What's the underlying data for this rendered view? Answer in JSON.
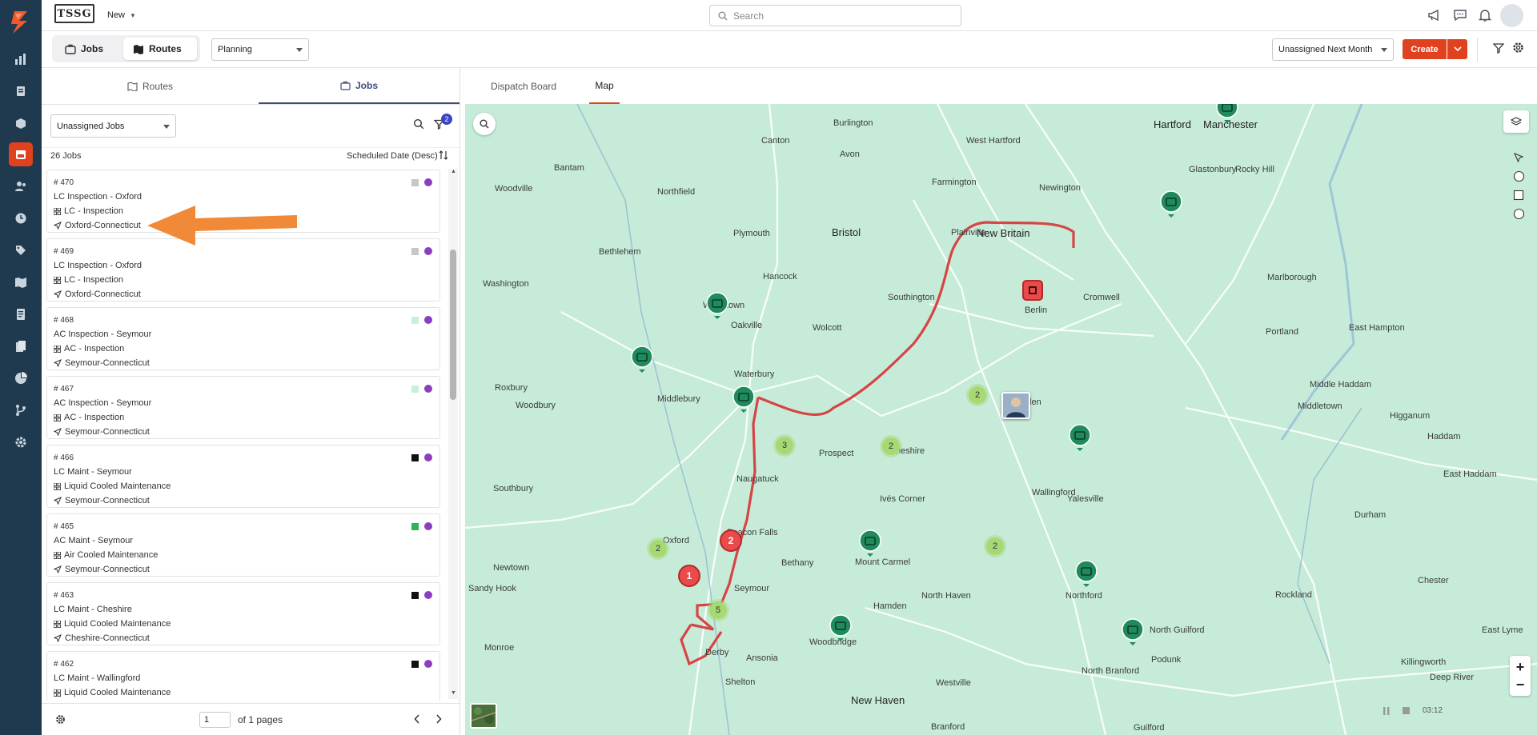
{
  "app": {
    "logo_text": "TSSG",
    "new_label": "New",
    "search_placeholder": "Search"
  },
  "subbar": {
    "jobs_tab": "Jobs",
    "routes_tab": "Routes",
    "mode_select": "Planning",
    "filter_select": "Unassigned Next Month",
    "create_label": "Create"
  },
  "panel": {
    "tabs": [
      "Routes",
      "Jobs"
    ],
    "active_tab": "Jobs",
    "list_select": "Unassigned Jobs",
    "filter_badge": "2",
    "count": "26 Jobs",
    "sort_label": "Scheduled Date (Desc)",
    "jobs": [
      {
        "num": "# 470",
        "title": "LC Inspection - Oxford",
        "type": "LC - Inspection",
        "loc": "Oxford-Connecticut",
        "swatch": "#c7c7c7"
      },
      {
        "num": "# 469",
        "title": "LC Inspection - Oxford",
        "type": "LC - Inspection",
        "loc": "Oxford-Connecticut",
        "swatch": "#c7c7c7"
      },
      {
        "num": "# 468",
        "title": "AC Inspection - Seymour",
        "type": "AC - Inspection",
        "loc": "Seymour-Connecticut",
        "swatch": "#c9f0d8"
      },
      {
        "num": "# 467",
        "title": "AC Inspection - Seymour",
        "type": "AC - Inspection",
        "loc": "Seymour-Connecticut",
        "swatch": "#c9f0d8"
      },
      {
        "num": "# 466",
        "title": "LC Maint - Seymour",
        "type": "Liquid Cooled Maintenance",
        "loc": "Seymour-Connecticut",
        "swatch": "#111111"
      },
      {
        "num": "# 465",
        "title": "AC Maint - Seymour",
        "type": "Air Cooled Maintenance",
        "loc": "Seymour-Connecticut",
        "swatch": "#2db35a"
      },
      {
        "num": "# 463",
        "title": "LC Maint - Cheshire",
        "type": "Liquid Cooled Maintenance",
        "loc": "Cheshire-Connecticut",
        "swatch": "#111111"
      },
      {
        "num": "# 462",
        "title": "LC Maint - Wallingford",
        "type": "Liquid Cooled Maintenance",
        "loc": "",
        "swatch": "#111111"
      }
    ],
    "page_value": "1",
    "pages_label": "of 1 pages"
  },
  "map": {
    "tabs": [
      "Dispatch Board",
      "Map"
    ],
    "active_tab": "Map",
    "time": "03:12",
    "towns": [
      "Hartford",
      "Manchester",
      "West Hartford",
      "Burlington",
      "Canton",
      "Avon",
      "Bantam",
      "Woodville",
      "Northfield",
      "Farmington",
      "Newington",
      "Glastonbury",
      "Rocky Hill",
      "Bristol",
      "Plainville",
      "New Britain",
      "Plymouth",
      "Bethlehem",
      "Washington",
      "Hancock",
      "Southington",
      "Berlin",
      "Cromwell",
      "Marlborough",
      "Watertown",
      "Oakville",
      "Wolcott",
      "Portland",
      "East Hampton",
      "Roxbury",
      "Waterbury",
      "Middlebury",
      "Meriden",
      "Middletown",
      "Middle Haddam",
      "Woodbury",
      "Prospect",
      "Cheshire",
      "Naugatuck",
      "Southbury",
      "Higganum",
      "Haddam",
      "East Haddam",
      "Wallingford",
      "Yalesville",
      "Ivés Corner",
      "Durham",
      "Oxford",
      "Beacon Falls",
      "Bethany",
      "Mount Carmel",
      "Newtown",
      "Seymour",
      "Chester",
      "Hamden",
      "North Haven",
      "Northford",
      "Rockland",
      "Woodbridge",
      "Ansonia",
      "Shelton",
      "North Guilford",
      "Killingworth",
      "Deep River",
      "East Lyme",
      "Westville",
      "New Haven",
      "Branford",
      "North Branford",
      "Guilford",
      "Podunk",
      "Sandy Hook",
      "Monroe",
      "Derby"
    ],
    "clusters": [
      "2",
      "3",
      "2",
      "2",
      "2",
      "5"
    ],
    "red_markers": [
      "2",
      "1"
    ]
  }
}
